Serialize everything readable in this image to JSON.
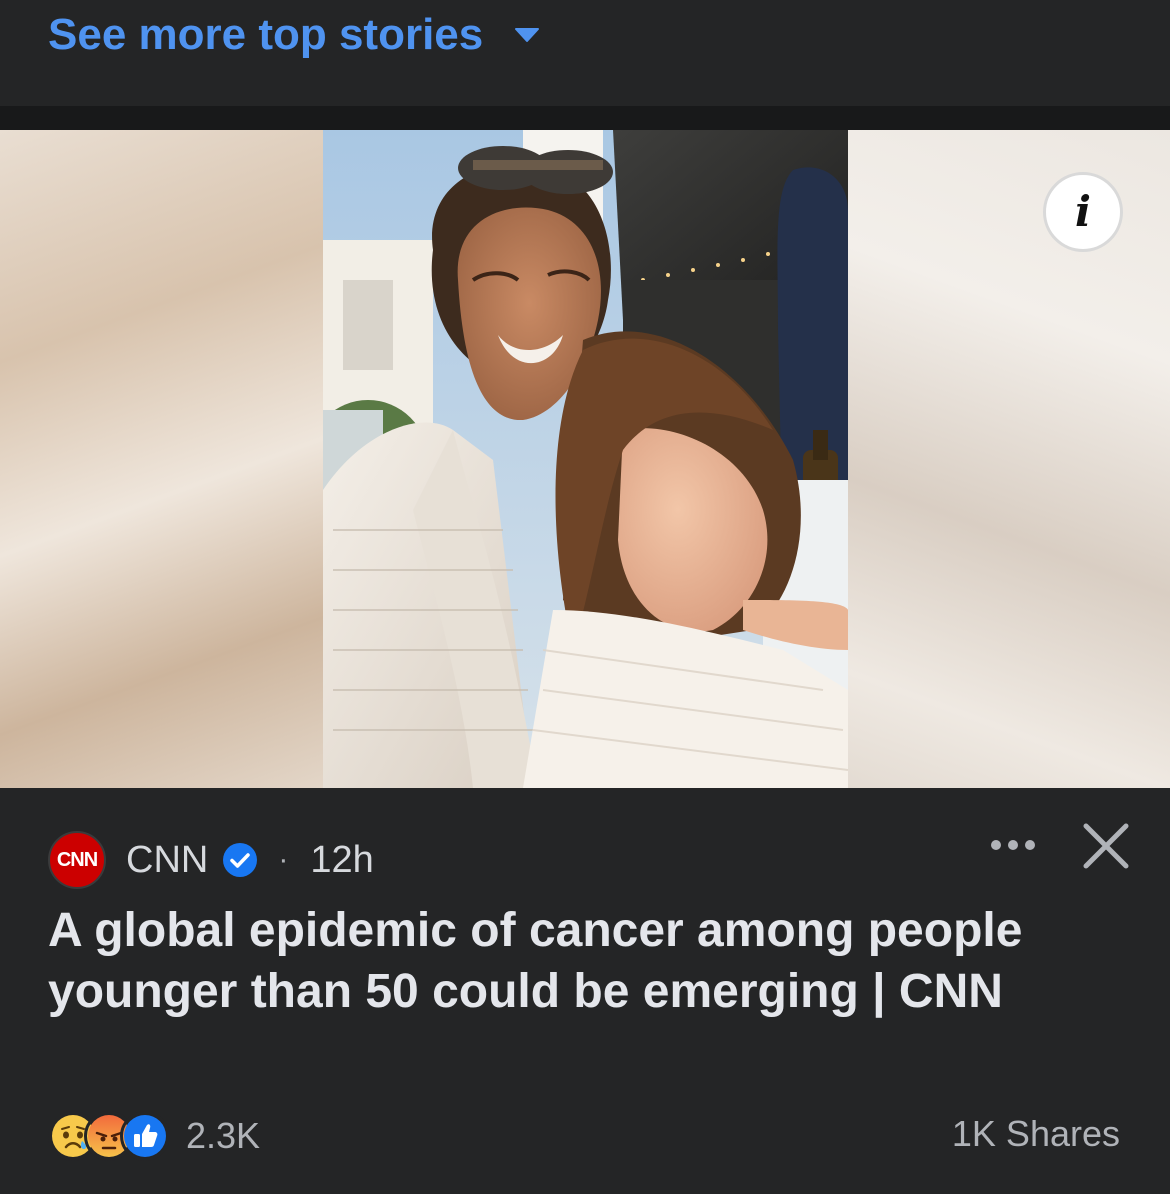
{
  "top": {
    "see_more_label": "See more top stories",
    "chevron_icon": "chevron-down-icon",
    "accent_color": "#4f93f0"
  },
  "media": {
    "info_icon": "info-icon",
    "photo_description_icon": "photo"
  },
  "post": {
    "source_logo_text": "CNN",
    "source_name": "CNN",
    "verified_icon": "verified-badge-icon",
    "separator": "·",
    "time": "12h",
    "more_icon": "more-horizontal-icon",
    "close_icon": "close-icon",
    "headline": "A global epidemic of cancer among people younger than 50 could be emerging | CNN",
    "reactions": [
      "sad",
      "angry",
      "like"
    ],
    "reaction_count": "2.3K",
    "shares": "1K Shares"
  },
  "colors": {
    "background": "#242526",
    "separator": "#18191a",
    "brand_red": "#cc0000",
    "verified_blue": "#1877f2"
  }
}
